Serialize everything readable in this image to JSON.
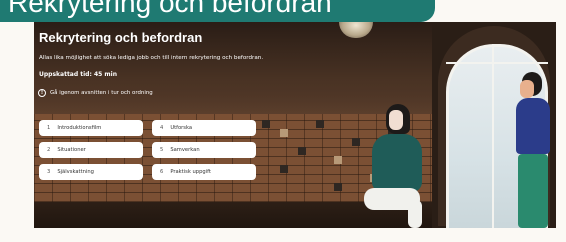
{
  "banner": {
    "title": "Rekrytering och befordran"
  },
  "hero": {
    "title": "Rekrytering och befordran",
    "subtitle": "Allas lika möjlighet att söka lediga jobb och till intern rekrytering och befordran.",
    "duration": "Uppskattad tid: 45 min",
    "info_text": "Gå igenom avsnitten i tur och ordning",
    "info_icon": "exclamation-circle-icon"
  },
  "modules": [
    {
      "number": "1",
      "label": "Introduktionsfilm"
    },
    {
      "number": "4",
      "label": "Utforska"
    },
    {
      "number": "2",
      "label": "Situationer"
    },
    {
      "number": "5",
      "label": "Samverkan"
    },
    {
      "number": "3",
      "label": "Självskattning"
    },
    {
      "number": "6",
      "label": "Praktisk uppgift"
    }
  ],
  "colors": {
    "banner": "#1f7a72",
    "module_bg": "#ffffff",
    "hero_text": "#ffffff"
  }
}
